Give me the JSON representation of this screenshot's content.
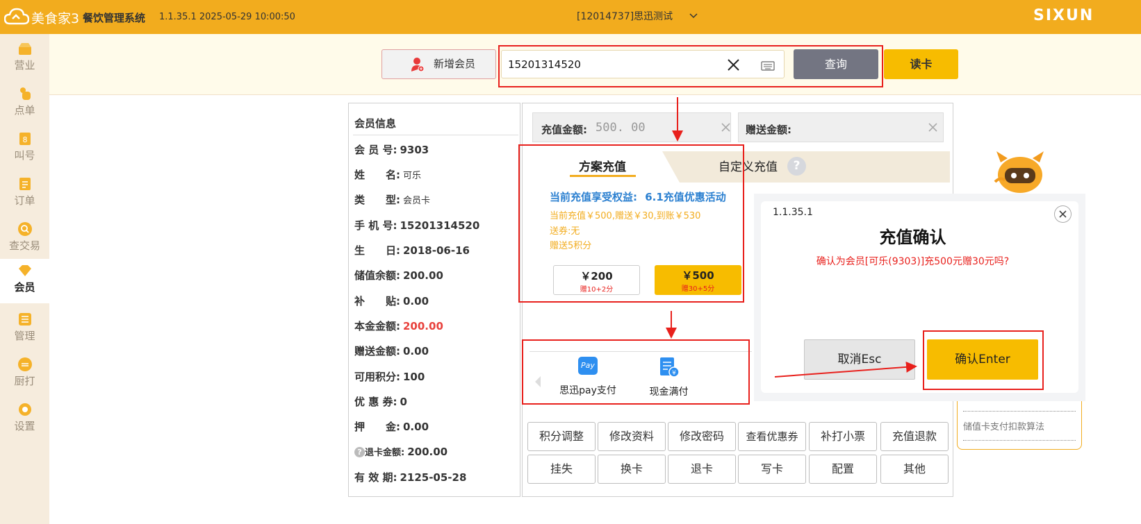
{
  "app": {
    "logo_text": "美食家3",
    "system_name": "餐饮管理系统",
    "version_time": "1.1.35.1 2025-05-29 10:00:50",
    "store": "[12014737]思迅测试",
    "brand": "SIXUN"
  },
  "sidebar": {
    "items": [
      {
        "label": "营业",
        "icon": "shop-icon"
      },
      {
        "label": "点单",
        "icon": "hand-icon"
      },
      {
        "label": "叫号",
        "icon": "number-icon"
      },
      {
        "label": "订单",
        "icon": "order-icon"
      },
      {
        "label": "查交易",
        "icon": "search-icon"
      },
      {
        "label": "会员",
        "icon": "diamond-icon"
      },
      {
        "label": "管理",
        "icon": "manage-icon"
      },
      {
        "label": "厨打",
        "icon": "kitchen-print-icon"
      },
      {
        "label": "设置",
        "icon": "gear-icon"
      }
    ]
  },
  "search": {
    "add_member": "新增会员",
    "value": "15201314520",
    "query": "查询",
    "read_card": "读卡"
  },
  "member": {
    "title": "会员信息",
    "rows": [
      {
        "label": "会 员 号:",
        "value": "9303"
      },
      {
        "label": "姓　　名:",
        "value": "可乐"
      },
      {
        "label": "类　　型:",
        "value": "会员卡"
      },
      {
        "label": "手 机 号:",
        "value": "15201314520"
      },
      {
        "label": "生　　日:",
        "value": "2018-06-16"
      },
      {
        "label": "储值余额:",
        "value": "200.00"
      },
      {
        "label": "补　　贴:",
        "value": "0.00"
      },
      {
        "label": "本金金额:",
        "value": "200.00"
      },
      {
        "label": "赠送金额:",
        "value": "0.00"
      },
      {
        "label": "可用积分:",
        "value": "100"
      },
      {
        "label": "优 惠 券:",
        "value": "0"
      },
      {
        "label": "押　　金:",
        "value": "0.00"
      },
      {
        "label": "退卡金额:",
        "value": "200.00"
      },
      {
        "label": "有 效 期:",
        "value": "2125-05-28"
      }
    ]
  },
  "recharge": {
    "amount_label": "充值金额:",
    "amount_value": "500. 00",
    "gift_label": "赠送金额:",
    "tab_plan": "方案充值",
    "tab_custom": "自定义充值",
    "benefit_title": "当前充值享受权益:",
    "benefit_name": "6.1充值优惠活动",
    "detail1": "当前充值￥500,赠送￥30,到账￥530",
    "detail2": "送券:无",
    "detail3": "赠送5积分",
    "plans": [
      {
        "price": "￥200",
        "gift": "赠10+2分"
      },
      {
        "price": "￥500",
        "gift": "赠30+5分"
      }
    ],
    "pay_methods": [
      "思迅pay支付",
      "现金满付"
    ],
    "pay_icon_text": "Pay"
  },
  "actions": {
    "row1": [
      "积分调整",
      "修改资料",
      "修改密码",
      "查看优惠券",
      "补打小票",
      "充值退款"
    ],
    "row2": [
      "挂失",
      "换卡",
      "退卡",
      "写卡",
      "配置",
      "其他"
    ]
  },
  "side_tip": "储值卡支付扣款算法",
  "dialog": {
    "version": "1.1.35.1",
    "title": "充值确认",
    "message": "确认为会员[可乐(9303)]充500元赠30元吗?",
    "cancel": "取消Esc",
    "confirm": "确认Enter"
  },
  "colors": {
    "accent": "#f2ac1e",
    "confirm": "#f7bc00",
    "highlight": "#e8201c",
    "link_blue": "#2a7fd0"
  }
}
